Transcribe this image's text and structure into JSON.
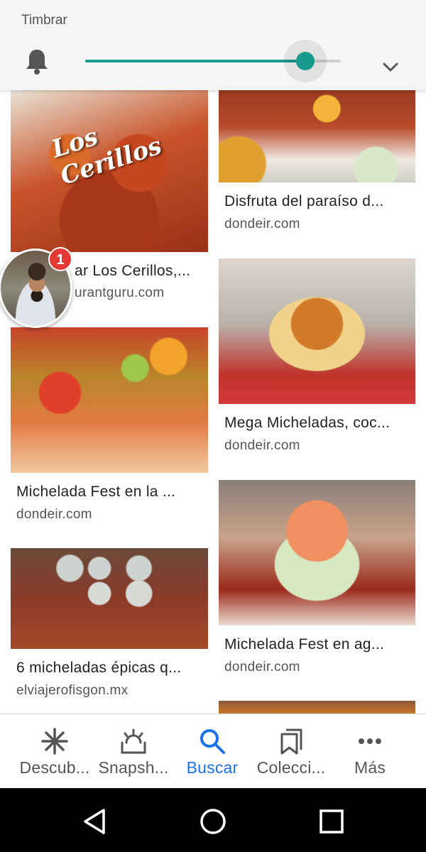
{
  "volume_panel": {
    "label": "Timbrar",
    "level": 0.86
  },
  "results": [
    {
      "title": "Visitar Los Cerillos,...",
      "visible_title": "ar Los Cerillos,...",
      "domain": "restaurantguru.com",
      "visible_domain": "urantguru.com",
      "image_text": "Los Cerillos",
      "image": "cerillos"
    },
    {
      "title": "Disfruta del paraíso d...",
      "domain": "dondeir.com",
      "image": "gummy"
    },
    {
      "title": "Mega Micheladas, coc...",
      "domain": "dondeir.com",
      "image": "mega"
    },
    {
      "title": "Michelada Fest en la ...",
      "domain": "dondeir.com",
      "image": "fest1"
    },
    {
      "title": "Michelada Fest en ag...",
      "domain": "dondeir.com",
      "image": "fest2"
    },
    {
      "title": "6 micheladas épicas q...",
      "domain": "elviajerofisgon.mx",
      "image": "cans"
    }
  ],
  "chat_head": {
    "badge_count": "1"
  },
  "bottom_nav": [
    {
      "label": "Descub...",
      "icon": "asterisk-icon",
      "active": false
    },
    {
      "label": "Snapsh...",
      "icon": "snapshot-icon",
      "active": false
    },
    {
      "label": "Buscar",
      "icon": "search-icon",
      "active": true
    },
    {
      "label": "Colecci...",
      "icon": "collections-icon",
      "active": false
    },
    {
      "label": "Más",
      "icon": "more-icon",
      "active": false
    }
  ],
  "colors": {
    "accent": "#1a9a8c",
    "active_nav": "#1a73e8",
    "badge": "#e53935"
  }
}
